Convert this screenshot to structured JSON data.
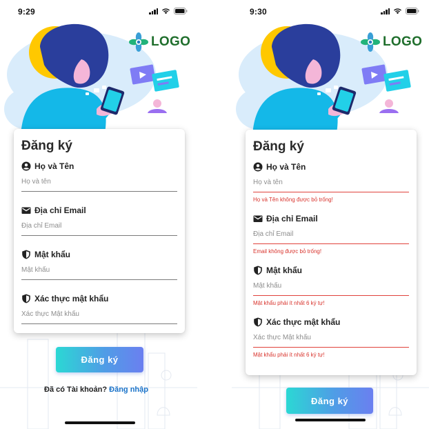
{
  "screens": [
    {
      "id": "register-empty",
      "status": {
        "time": "9:29"
      },
      "logo": {
        "text": "LOGO"
      },
      "form": {
        "title": "Đăng ký",
        "fields": [
          {
            "icon": "person-circle-icon",
            "label": "Họ và Tên",
            "placeholder": "Họ và tên",
            "value": "",
            "error": ""
          },
          {
            "icon": "mail-icon",
            "label": "Địa chỉ Email",
            "placeholder": "Địa chỉ Email",
            "value": "",
            "error": ""
          },
          {
            "icon": "shield-icon",
            "label": "Mật khẩu",
            "placeholder": "Mật khẩu",
            "value": "",
            "error": ""
          },
          {
            "icon": "shield-icon",
            "label": "Xác thực mật khẩu",
            "placeholder": "Xác thực Mật khẩu",
            "value": "",
            "error": ""
          }
        ]
      },
      "submit_label": "Đăng ký",
      "signin_prompt": "Đã có Tài khoản?",
      "signin_link": "Đăng nhập"
    },
    {
      "id": "register-errors",
      "status": {
        "time": "9:30"
      },
      "logo": {
        "text": "LOGO"
      },
      "form": {
        "title": "Đăng ký",
        "fields": [
          {
            "icon": "person-circle-icon",
            "label": "Họ và Tên",
            "placeholder": "Họ và tên",
            "value": "",
            "error": "Họ và Tên không được bỏ trống!"
          },
          {
            "icon": "mail-icon",
            "label": "Địa chỉ Email",
            "placeholder": "Địa chỉ Email",
            "value": "",
            "error": "Email không được bỏ trống!"
          },
          {
            "icon": "shield-icon",
            "label": "Mật khẩu",
            "placeholder": "Mật khẩu",
            "value": "",
            "error": "Mật khẩu phải ít nhất 6 ký tự!"
          },
          {
            "icon": "shield-icon",
            "label": "Xác thực mật khẩu",
            "placeholder": "Xác thực Mật khẩu",
            "value": "",
            "error": "Mật khẩu phải ít nhất 6 ký tự!"
          }
        ]
      },
      "submit_label": "Đăng ký"
    }
  ],
  "colors": {
    "accent_start": "#2bd8d4",
    "accent_end": "#6b7ff0",
    "link": "#1a73c9",
    "error": "#d8322b",
    "logo_text": "#1f6e2c"
  }
}
